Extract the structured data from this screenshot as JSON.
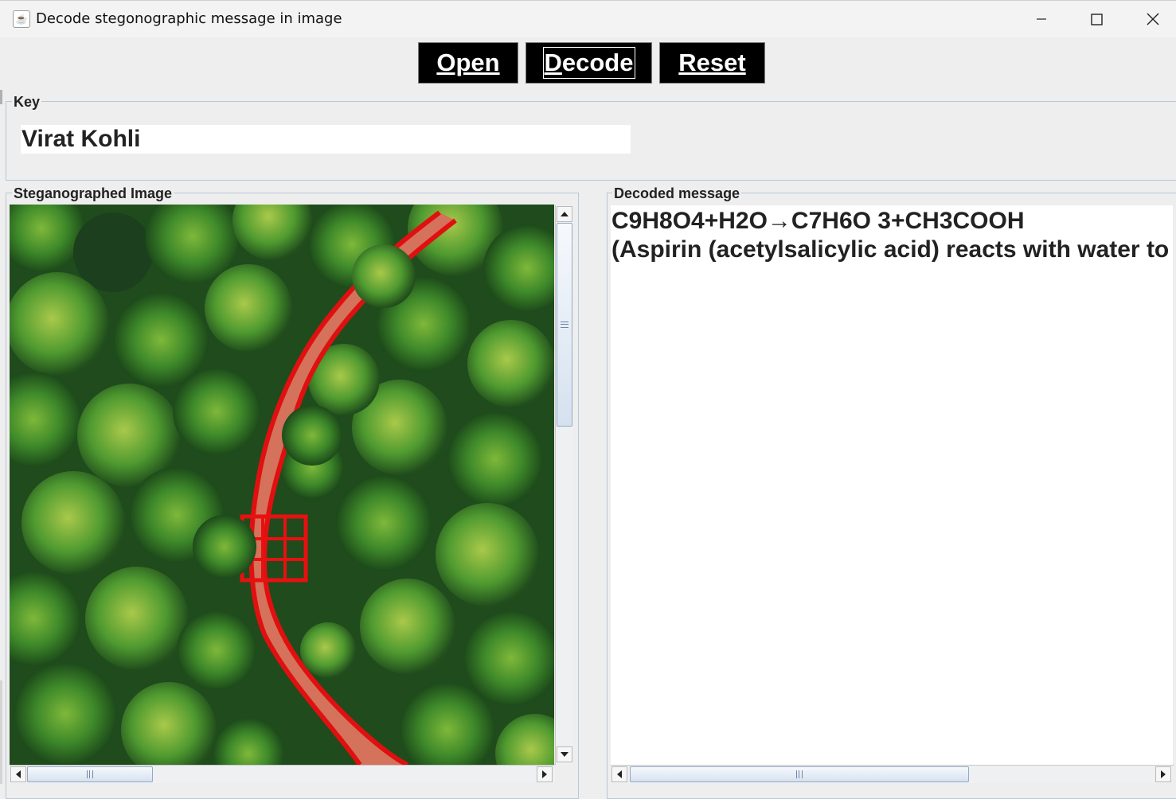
{
  "window": {
    "title": "Decode stegonographic message in image",
    "icon": "java-cup-icon"
  },
  "toolbar": {
    "open_label": "Open",
    "decode_first": "D",
    "decode_rest": "ecode",
    "reset_label": "Reset",
    "button_bg": "#000000",
    "button_fg": "#ffffff"
  },
  "key": {
    "group_label": "Key",
    "value": "Virat Kohli"
  },
  "image_panel": {
    "group_label": "Steganographed Image",
    "content": "aerial-forest-red-bridge-image"
  },
  "message_panel": {
    "group_label": "Decoded message",
    "lines": [
      "C9H8O4+H2O→C7H6O 3+CH3COOH",
      "(Aspirin (acetylsalicylic acid) reacts with water to"
    ]
  },
  "colors": {
    "window_bg": "#eeeeee",
    "group_border": "#b8c7d8",
    "scroll_thumb": "#d6e1ef"
  }
}
